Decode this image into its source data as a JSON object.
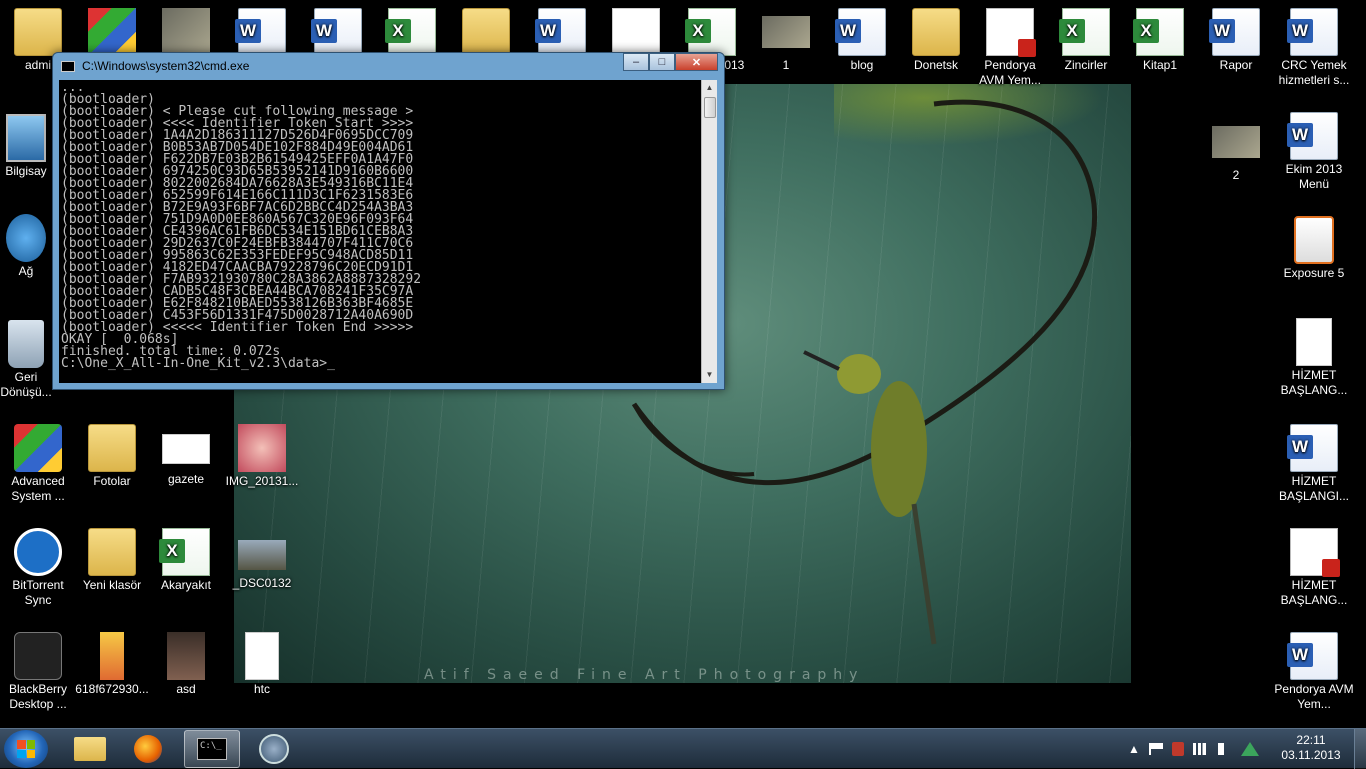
{
  "wallpaper": {
    "watermark": "Atif Saeed Fine Art Photography"
  },
  "desktop_icons": [
    {
      "label": "admi",
      "type": "folder"
    },
    {
      "label": "",
      "type": "app"
    },
    {
      "label": "",
      "type": "photo"
    },
    {
      "label": "",
      "type": "word"
    },
    {
      "label": "",
      "type": "word"
    },
    {
      "label": "",
      "type": "excel"
    },
    {
      "label": "",
      "type": "folder"
    },
    {
      "label": "",
      "type": "word"
    },
    {
      "label": "",
      "type": "doc"
    },
    {
      "label": "2013",
      "type": "excel"
    },
    {
      "label": "1",
      "type": "photo"
    },
    {
      "label": "blog",
      "type": "word"
    },
    {
      "label": "Donetsk",
      "type": "folder"
    },
    {
      "label": "Pendorya AVM Yem...",
      "type": "pdf"
    },
    {
      "label": "Zincirler",
      "type": "excel"
    },
    {
      "label": "Kitap1",
      "type": "excel"
    },
    {
      "label": "Rapor",
      "type": "word"
    },
    {
      "label": "CRC Yemek hizmetleri s...",
      "type": "word"
    },
    {
      "label": "Bilgisay",
      "type": "computer"
    },
    {
      "label": "2",
      "type": "photo"
    },
    {
      "label": "Ekim 2013 Menü",
      "type": "word"
    },
    {
      "label": "Ağ",
      "type": "network"
    },
    {
      "label": "Exposure 5",
      "type": "app"
    },
    {
      "label": "Geri Dönüşü...",
      "type": "recycle"
    },
    {
      "label": "HİZMET BAŞLANG...",
      "type": "doc"
    },
    {
      "label": "Advanced System ...",
      "type": "app"
    },
    {
      "label": "Fotolar",
      "type": "folder"
    },
    {
      "label": "gazete",
      "type": "doc"
    },
    {
      "label": "IMG_20131...",
      "type": "photo"
    },
    {
      "label": "HİZMET BAŞLANGI...",
      "type": "word"
    },
    {
      "label": "BitTorrent Sync",
      "type": "app"
    },
    {
      "label": "Yeni klasör",
      "type": "folder"
    },
    {
      "label": "Akaryakıt",
      "type": "excel"
    },
    {
      "label": "_DSC0132",
      "type": "photo"
    },
    {
      "label": "HİZMET BAŞLANG...",
      "type": "pdf"
    },
    {
      "label": "BlackBerry Desktop ...",
      "type": "app"
    },
    {
      "label": "618f672930...",
      "type": "photo"
    },
    {
      "label": "asd",
      "type": "photo"
    },
    {
      "label": "htc",
      "type": "doc"
    },
    {
      "label": "Pendorya AVM Yem...",
      "type": "word"
    }
  ],
  "cmd_window": {
    "title": "C:\\Windows\\system32\\cmd.exe",
    "buttons": {
      "minimize": "–",
      "maximize": "□",
      "close": "✕"
    },
    "lines": [
      "...",
      "(bootloader)",
      "(bootloader) < Please cut following message >",
      "(bootloader) <<<< Identifier Token Start >>>>",
      "(bootloader) 1A4A2D186311127D526D4F0695DCC709",
      "(bootloader) B0B53AB7D054DE102F884D49E004AD61",
      "(bootloader) F622DB7E03B2B61549425EFF0A1A47F0",
      "(bootloader) 6974250C93D65B53952141D9160B6600",
      "(bootloader) 8022002684DA76628A3E549316BC11E4",
      "(bootloader) 652599F614E166C111D3C1F6231583E6",
      "(bootloader) B72E9A93F6BF7AC6D2BBCC4D254A3BA3",
      "(bootloader) 751D9A0D0EE860A567C320E96F093F64",
      "(bootloader) CE4396AC61FB6DC534E151BD61CEB8A3",
      "(bootloader) 29D2637C0F24EBFB3844707F411C70C6",
      "(bootloader) 995863C62E353FEDEF95C948ACD85D11",
      "(bootloader) 4182ED47CAACBA79228796C20ECD91D1",
      "(bootloader) F7AB9321930780C28A3862A8887328292",
      "(bootloader) CADB5C48F3CBEA44BCA708241F35C97A",
      "(bootloader) E62F848210BAED5538126B363BF4685E",
      "(bootloader) C453F56D1331F475D0028712A40A690D",
      "(bootloader) <<<<< Identifier Token End >>>>>",
      "OKAY [  0.068s]",
      "finished. total time: 0.072s",
      "",
      "C:\\One_X_All-In-One_Kit_v2.3\\data>_"
    ]
  },
  "taskbar": {
    "items": [
      "explorer",
      "firefox",
      "cmd",
      "unknown-app"
    ],
    "tray_arrow": "▲",
    "clock": {
      "time": "22:11",
      "date": "03.11.2013"
    }
  }
}
